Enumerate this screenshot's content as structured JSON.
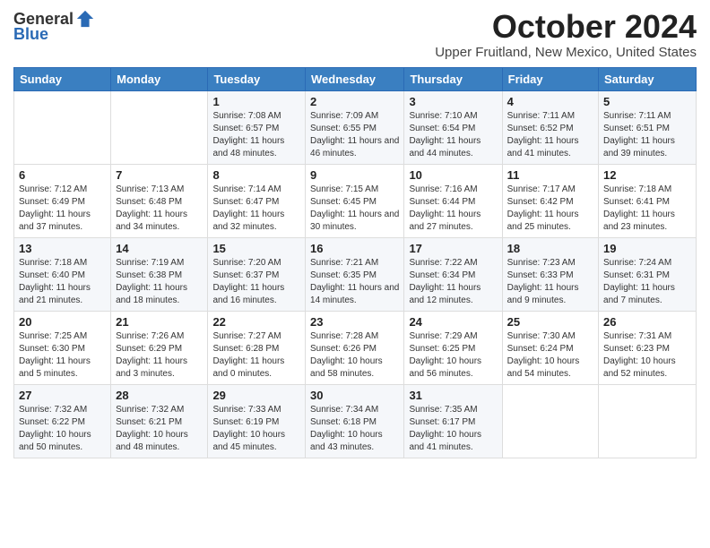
{
  "header": {
    "logo_general": "General",
    "logo_blue": "Blue",
    "month_title": "October 2024",
    "location": "Upper Fruitland, New Mexico, United States"
  },
  "days_of_week": [
    "Sunday",
    "Monday",
    "Tuesday",
    "Wednesday",
    "Thursday",
    "Friday",
    "Saturday"
  ],
  "weeks": [
    [
      {
        "day": "",
        "text": ""
      },
      {
        "day": "",
        "text": ""
      },
      {
        "day": "1",
        "text": "Sunrise: 7:08 AM\nSunset: 6:57 PM\nDaylight: 11 hours and 48 minutes."
      },
      {
        "day": "2",
        "text": "Sunrise: 7:09 AM\nSunset: 6:55 PM\nDaylight: 11 hours and 46 minutes."
      },
      {
        "day": "3",
        "text": "Sunrise: 7:10 AM\nSunset: 6:54 PM\nDaylight: 11 hours and 44 minutes."
      },
      {
        "day": "4",
        "text": "Sunrise: 7:11 AM\nSunset: 6:52 PM\nDaylight: 11 hours and 41 minutes."
      },
      {
        "day": "5",
        "text": "Sunrise: 7:11 AM\nSunset: 6:51 PM\nDaylight: 11 hours and 39 minutes."
      }
    ],
    [
      {
        "day": "6",
        "text": "Sunrise: 7:12 AM\nSunset: 6:49 PM\nDaylight: 11 hours and 37 minutes."
      },
      {
        "day": "7",
        "text": "Sunrise: 7:13 AM\nSunset: 6:48 PM\nDaylight: 11 hours and 34 minutes."
      },
      {
        "day": "8",
        "text": "Sunrise: 7:14 AM\nSunset: 6:47 PM\nDaylight: 11 hours and 32 minutes."
      },
      {
        "day": "9",
        "text": "Sunrise: 7:15 AM\nSunset: 6:45 PM\nDaylight: 11 hours and 30 minutes."
      },
      {
        "day": "10",
        "text": "Sunrise: 7:16 AM\nSunset: 6:44 PM\nDaylight: 11 hours and 27 minutes."
      },
      {
        "day": "11",
        "text": "Sunrise: 7:17 AM\nSunset: 6:42 PM\nDaylight: 11 hours and 25 minutes."
      },
      {
        "day": "12",
        "text": "Sunrise: 7:18 AM\nSunset: 6:41 PM\nDaylight: 11 hours and 23 minutes."
      }
    ],
    [
      {
        "day": "13",
        "text": "Sunrise: 7:18 AM\nSunset: 6:40 PM\nDaylight: 11 hours and 21 minutes."
      },
      {
        "day": "14",
        "text": "Sunrise: 7:19 AM\nSunset: 6:38 PM\nDaylight: 11 hours and 18 minutes."
      },
      {
        "day": "15",
        "text": "Sunrise: 7:20 AM\nSunset: 6:37 PM\nDaylight: 11 hours and 16 minutes."
      },
      {
        "day": "16",
        "text": "Sunrise: 7:21 AM\nSunset: 6:35 PM\nDaylight: 11 hours and 14 minutes."
      },
      {
        "day": "17",
        "text": "Sunrise: 7:22 AM\nSunset: 6:34 PM\nDaylight: 11 hours and 12 minutes."
      },
      {
        "day": "18",
        "text": "Sunrise: 7:23 AM\nSunset: 6:33 PM\nDaylight: 11 hours and 9 minutes."
      },
      {
        "day": "19",
        "text": "Sunrise: 7:24 AM\nSunset: 6:31 PM\nDaylight: 11 hours and 7 minutes."
      }
    ],
    [
      {
        "day": "20",
        "text": "Sunrise: 7:25 AM\nSunset: 6:30 PM\nDaylight: 11 hours and 5 minutes."
      },
      {
        "day": "21",
        "text": "Sunrise: 7:26 AM\nSunset: 6:29 PM\nDaylight: 11 hours and 3 minutes."
      },
      {
        "day": "22",
        "text": "Sunrise: 7:27 AM\nSunset: 6:28 PM\nDaylight: 11 hours and 0 minutes."
      },
      {
        "day": "23",
        "text": "Sunrise: 7:28 AM\nSunset: 6:26 PM\nDaylight: 10 hours and 58 minutes."
      },
      {
        "day": "24",
        "text": "Sunrise: 7:29 AM\nSunset: 6:25 PM\nDaylight: 10 hours and 56 minutes."
      },
      {
        "day": "25",
        "text": "Sunrise: 7:30 AM\nSunset: 6:24 PM\nDaylight: 10 hours and 54 minutes."
      },
      {
        "day": "26",
        "text": "Sunrise: 7:31 AM\nSunset: 6:23 PM\nDaylight: 10 hours and 52 minutes."
      }
    ],
    [
      {
        "day": "27",
        "text": "Sunrise: 7:32 AM\nSunset: 6:22 PM\nDaylight: 10 hours and 50 minutes."
      },
      {
        "day": "28",
        "text": "Sunrise: 7:32 AM\nSunset: 6:21 PM\nDaylight: 10 hours and 48 minutes."
      },
      {
        "day": "29",
        "text": "Sunrise: 7:33 AM\nSunset: 6:19 PM\nDaylight: 10 hours and 45 minutes."
      },
      {
        "day": "30",
        "text": "Sunrise: 7:34 AM\nSunset: 6:18 PM\nDaylight: 10 hours and 43 minutes."
      },
      {
        "day": "31",
        "text": "Sunrise: 7:35 AM\nSunset: 6:17 PM\nDaylight: 10 hours and 41 minutes."
      },
      {
        "day": "",
        "text": ""
      },
      {
        "day": "",
        "text": ""
      }
    ]
  ]
}
